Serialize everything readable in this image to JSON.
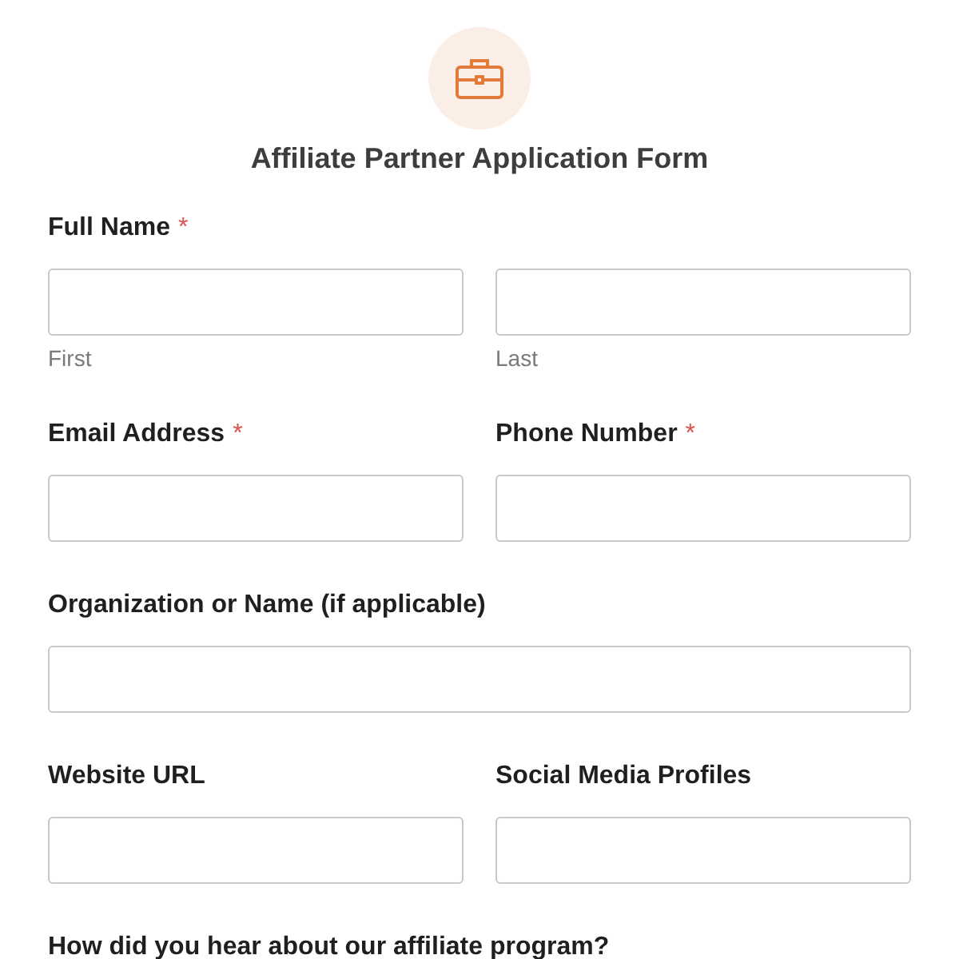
{
  "form": {
    "title": "Affiliate Partner Application Form"
  },
  "rows": [
    {
      "fields": [
        {
          "label": "Full Name",
          "required_mark": "*",
          "kind": "group",
          "parts": [
            {
              "sublabel": "First"
            },
            {
              "sublabel": "Last"
            }
          ]
        }
      ]
    },
    {
      "fields": [
        {
          "label": "Email Address",
          "required_mark": "*",
          "kind": "input"
        },
        {
          "label": "Phone Number",
          "required_mark": "*",
          "kind": "input"
        }
      ]
    },
    {
      "fields": [
        {
          "label": "Organization or Name (if applicable)",
          "kind": "input"
        }
      ]
    },
    {
      "fields": [
        {
          "label": "Website URL",
          "kind": "input"
        },
        {
          "label": "Social Media Profiles",
          "kind": "input"
        }
      ]
    },
    {
      "fields": [
        {
          "label": "How did you hear about our affiliate program?",
          "kind": "question"
        }
      ]
    }
  ]
}
